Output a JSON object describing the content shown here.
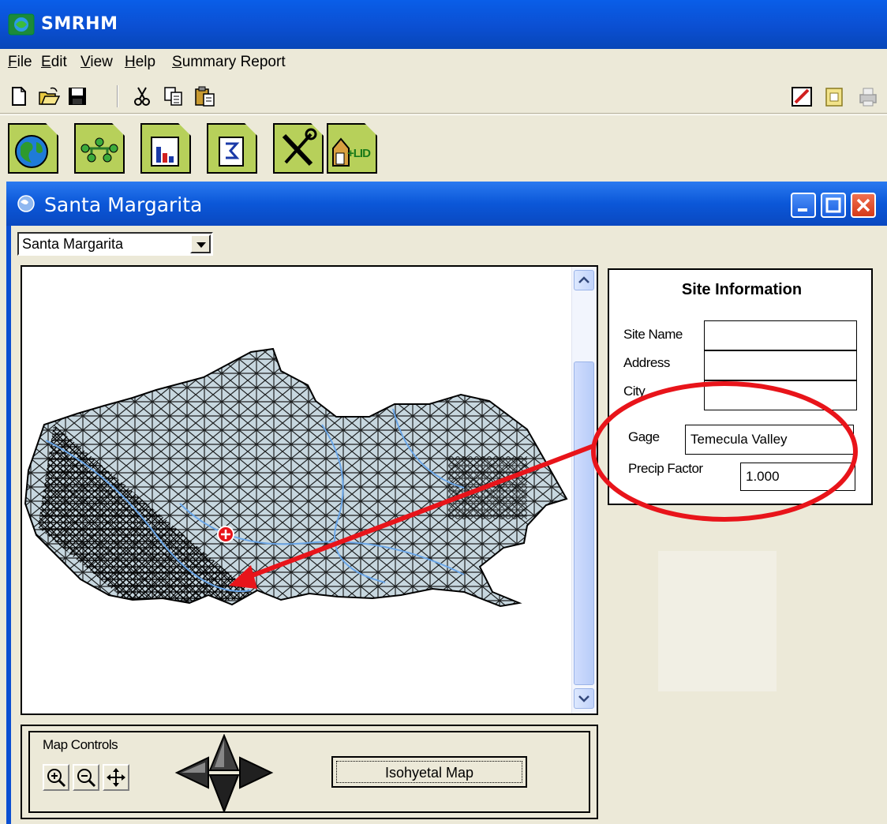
{
  "app": {
    "title": "SMRHM"
  },
  "menu": [
    "File",
    "Edit",
    "View",
    "Help",
    "Summary Report"
  ],
  "toolbar": {
    "left_icons": [
      "new-file-icon",
      "open-folder-icon",
      "save-icon",
      "cut-icon",
      "copy-icon",
      "paste-icon"
    ],
    "right_icons": [
      "edit-icon",
      "notes-icon",
      "print-icon"
    ]
  },
  "big_buttons": [
    "globe-icon",
    "network-icon",
    "bar-chart-icon",
    "report-icon",
    "tools-icon",
    "lid-icon"
  ],
  "big_buttons_lid_text": "+LID",
  "window": {
    "title": "Santa Margarita"
  },
  "watershed_select": {
    "value": "Santa Margarita"
  },
  "site_info": {
    "title": "Site Information",
    "site_name_label": "Site Name",
    "address_label": "Address",
    "city_label": "City",
    "gage_label": "Gage",
    "gage_value": "Temecula Valley",
    "precip_label": "Precip Factor",
    "precip_value": "1.000"
  },
  "map_controls": {
    "title": "Map Controls",
    "isohyetal_label": "Isohyetal Map"
  },
  "colors": {
    "titlebar": "#0b4fd2",
    "map_fill": "#c7d7df",
    "annotation": "#e8141a",
    "stream": "#6aa6e8"
  }
}
